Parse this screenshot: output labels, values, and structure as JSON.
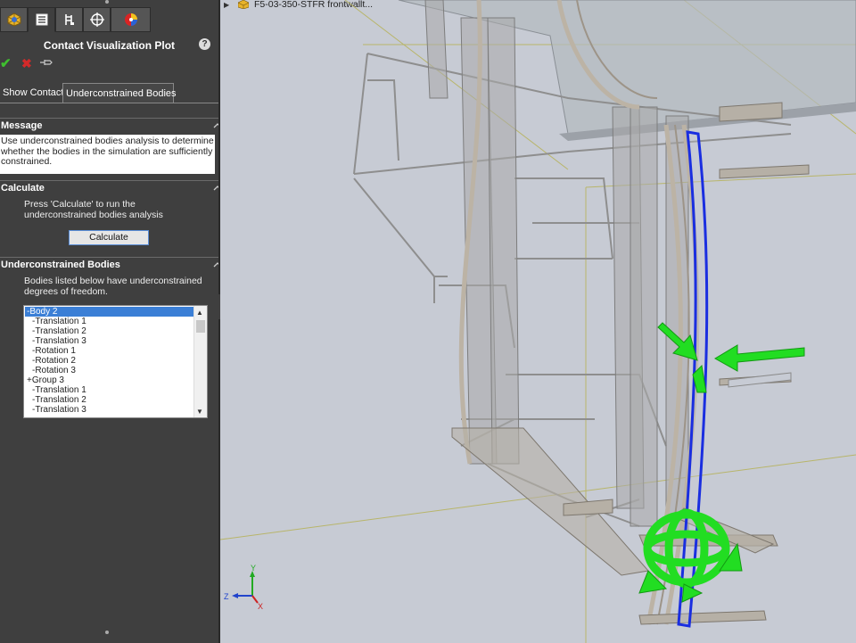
{
  "panel": {
    "title": "Contact Visualization Plot",
    "help_icon": "?",
    "tabs": [
      {
        "icon": "simulation-icon"
      },
      {
        "icon": "property-manager-icon"
      },
      {
        "icon": "configuration-icon"
      },
      {
        "icon": "dimxpert-icon"
      },
      {
        "icon": "display-manager-icon"
      }
    ],
    "actions": {
      "ok_icon": "checkmark-icon",
      "cancel_icon": "close-icon",
      "pin_icon": "pushpin-icon"
    },
    "subtabs": [
      {
        "label": "Show Contact"
      },
      {
        "label": "Underconstrained Bodies"
      }
    ],
    "sections": {
      "message": {
        "title": "Message",
        "text": "Use underconstrained bodies analysis to determine whether the bodies in the simulation are sufficiently constrained."
      },
      "calculate": {
        "title": "Calculate",
        "text": "Press 'Calculate' to run the underconstrained bodies analysis",
        "button": "Calculate"
      },
      "underconstrained": {
        "title": "Underconstrained Bodies",
        "text": "Bodies listed below have underconstrained degrees of freedom.",
        "items": [
          {
            "label": "-Body 2",
            "selected": true
          },
          {
            "label": "-Translation 1"
          },
          {
            "label": "-Translation 2"
          },
          {
            "label": "-Translation 3"
          },
          {
            "label": "-Rotation 1"
          },
          {
            "label": "-Rotation 2"
          },
          {
            "label": "-Rotation 3"
          },
          {
            "label": "+Group 3"
          },
          {
            "label": "-Translation 1"
          },
          {
            "label": "-Translation 2"
          },
          {
            "label": "-Translation 3"
          }
        ]
      }
    }
  },
  "viewport": {
    "breadcrumb": "F5-03-350-STFR frontwallt...",
    "background": "#c7cbd4",
    "highlight_color": "#1a2ee0",
    "dof_arrow_color": "#22dd22",
    "triad": {
      "x": "X",
      "y": "Y",
      "z": "Z"
    }
  }
}
